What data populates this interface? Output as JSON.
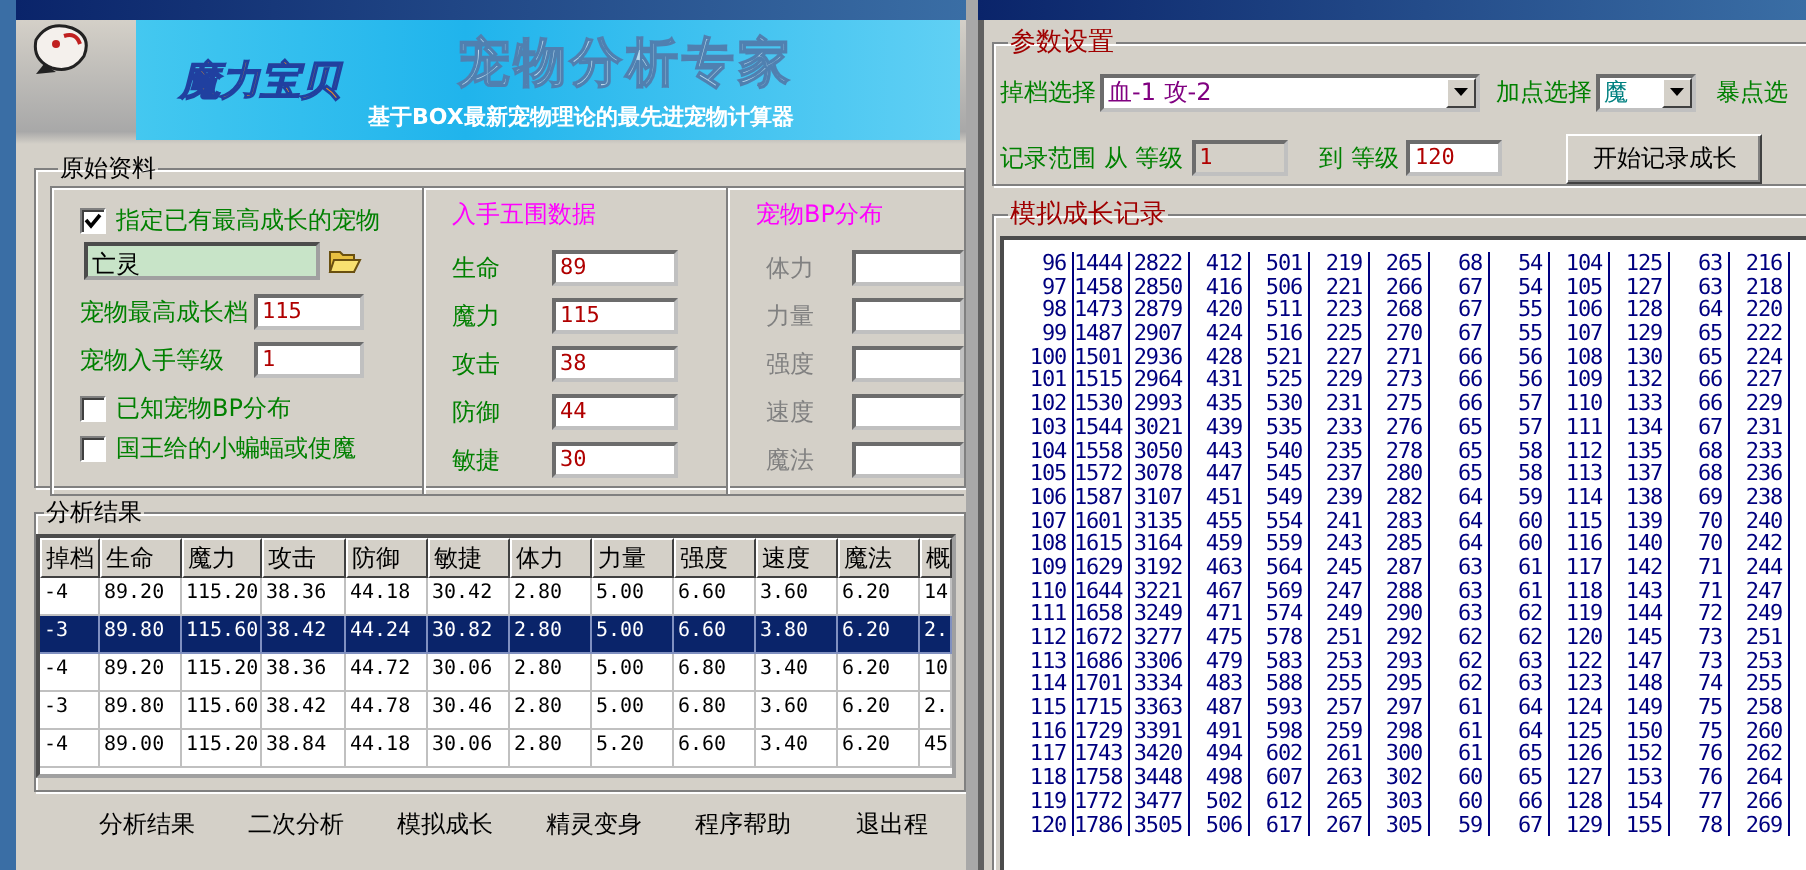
{
  "left_window": {
    "banner": {
      "logo": "魔力宝贝",
      "title": "宠物分析专家",
      "subtitle": "基于BOX最新宠物理论的最先进宠物计算器"
    },
    "original_data": {
      "title": "原始资料",
      "specify_pet": {
        "label": "指定已有最高成长的宠物",
        "checked": true
      },
      "pet_name": "亡灵",
      "max_growth": {
        "label": "宠物最高成长档",
        "value": "115"
      },
      "start_level": {
        "label": "宠物入手等级",
        "value": "1"
      },
      "options": [
        {
          "label": "已知宠物BP分布",
          "checked": false
        },
        {
          "label": "国王给的小蝙蝠或使魔",
          "checked": false
        }
      ],
      "stats": {
        "title": "入手五围数据",
        "fields": [
          {
            "label": "生命",
            "value": "89"
          },
          {
            "label": "魔力",
            "value": "115"
          },
          {
            "label": "攻击",
            "value": "38"
          },
          {
            "label": "防御",
            "value": "44"
          },
          {
            "label": "敏捷",
            "value": "30"
          }
        ]
      },
      "bp": {
        "title": "宠物BP分布",
        "disabled": true,
        "fields": [
          {
            "label": "体力"
          },
          {
            "label": "力量"
          },
          {
            "label": "强度"
          },
          {
            "label": "速度"
          },
          {
            "label": "魔法"
          }
        ]
      }
    },
    "results": {
      "title": "分析结果",
      "columns": [
        "掉档",
        "生命",
        "魔力",
        "攻击",
        "防御",
        "敏捷",
        "体力",
        "力量",
        "强度",
        "速度",
        "魔法",
        "概"
      ],
      "rows": [
        {
          "selected": false,
          "cells": [
            "-4",
            "89.20",
            "115.20",
            "38.36",
            "44.18",
            "30.42",
            "2.80",
            "5.00",
            "6.60",
            "3.60",
            "6.20",
            "14"
          ]
        },
        {
          "selected": true,
          "cells": [
            "-3",
            "89.80",
            "115.60",
            "38.42",
            "44.24",
            "30.82",
            "2.80",
            "5.00",
            "6.60",
            "3.80",
            "6.20",
            "2."
          ]
        },
        {
          "selected": false,
          "cells": [
            "-4",
            "89.20",
            "115.20",
            "38.36",
            "44.72",
            "30.06",
            "2.80",
            "5.00",
            "6.80",
            "3.40",
            "6.20",
            "10"
          ]
        },
        {
          "selected": false,
          "cells": [
            "-3",
            "89.80",
            "115.60",
            "38.42",
            "44.78",
            "30.46",
            "2.80",
            "5.00",
            "6.80",
            "3.60",
            "6.20",
            "2."
          ]
        },
        {
          "selected": false,
          "cells": [
            "-4",
            "89.00",
            "115.20",
            "38.84",
            "44.18",
            "30.06",
            "2.80",
            "5.20",
            "6.60",
            "3.40",
            "6.20",
            "45"
          ]
        }
      ]
    },
    "buttons": [
      "分析结果",
      "二次分析",
      "模拟成长",
      "精灵变身",
      "程序帮助",
      "退出程"
    ]
  },
  "right_window": {
    "params": {
      "title": "参数设置",
      "drop_select": {
        "label": "掉档选择",
        "value": "血-1 攻-2"
      },
      "point_select": {
        "label": "加点选择",
        "value": "魔"
      },
      "crit_label": "暴点选",
      "range_from_label": "记录范围 从 等级",
      "from_value": "1",
      "range_to_label": "到 等级",
      "to_value": "120",
      "start_button": "开始记录成长"
    },
    "record": {
      "title": "模拟成长记录",
      "rows": [
        [
          "96",
          "1444",
          "2822",
          "412",
          "501",
          "219",
          "265",
          "68",
          "54",
          "104",
          "125",
          "63",
          "216"
        ],
        [
          "97",
          "1458",
          "2850",
          "416",
          "506",
          "221",
          "266",
          "67",
          "54",
          "105",
          "127",
          "63",
          "218"
        ],
        [
          "98",
          "1473",
          "2879",
          "420",
          "511",
          "223",
          "268",
          "67",
          "55",
          "106",
          "128",
          "64",
          "220"
        ],
        [
          "99",
          "1487",
          "2907",
          "424",
          "516",
          "225",
          "270",
          "67",
          "55",
          "107",
          "129",
          "65",
          "222"
        ],
        [
          "100",
          "1501",
          "2936",
          "428",
          "521",
          "227",
          "271",
          "66",
          "56",
          "108",
          "130",
          "65",
          "224"
        ],
        [
          "101",
          "1515",
          "2964",
          "431",
          "525",
          "229",
          "273",
          "66",
          "56",
          "109",
          "132",
          "66",
          "227"
        ],
        [
          "102",
          "1530",
          "2993",
          "435",
          "530",
          "231",
          "275",
          "66",
          "57",
          "110",
          "133",
          "66",
          "229"
        ],
        [
          "103",
          "1544",
          "3021",
          "439",
          "535",
          "233",
          "276",
          "65",
          "57",
          "111",
          "134",
          "67",
          "231"
        ],
        [
          "104",
          "1558",
          "3050",
          "443",
          "540",
          "235",
          "278",
          "65",
          "58",
          "112",
          "135",
          "68",
          "233"
        ],
        [
          "105",
          "1572",
          "3078",
          "447",
          "545",
          "237",
          "280",
          "65",
          "58",
          "113",
          "137",
          "68",
          "236"
        ],
        [
          "106",
          "1587",
          "3107",
          "451",
          "549",
          "239",
          "282",
          "64",
          "59",
          "114",
          "138",
          "69",
          "238"
        ],
        [
          "107",
          "1601",
          "3135",
          "455",
          "554",
          "241",
          "283",
          "64",
          "60",
          "115",
          "139",
          "70",
          "240"
        ],
        [
          "108",
          "1615",
          "3164",
          "459",
          "559",
          "243",
          "285",
          "64",
          "60",
          "116",
          "140",
          "70",
          "242"
        ],
        [
          "109",
          "1629",
          "3192",
          "463",
          "564",
          "245",
          "287",
          "63",
          "61",
          "117",
          "142",
          "71",
          "244"
        ],
        [
          "110",
          "1644",
          "3221",
          "467",
          "569",
          "247",
          "288",
          "63",
          "61",
          "118",
          "143",
          "71",
          "247"
        ],
        [
          "111",
          "1658",
          "3249",
          "471",
          "574",
          "249",
          "290",
          "63",
          "62",
          "119",
          "144",
          "72",
          "249"
        ],
        [
          "112",
          "1672",
          "3277",
          "475",
          "578",
          "251",
          "292",
          "62",
          "62",
          "120",
          "145",
          "73",
          "251"
        ],
        [
          "113",
          "1686",
          "3306",
          "479",
          "583",
          "253",
          "293",
          "62",
          "63",
          "122",
          "147",
          "73",
          "253"
        ],
        [
          "114",
          "1701",
          "3334",
          "483",
          "588",
          "255",
          "295",
          "62",
          "63",
          "123",
          "148",
          "74",
          "255"
        ],
        [
          "115",
          "1715",
          "3363",
          "487",
          "593",
          "257",
          "297",
          "61",
          "64",
          "124",
          "149",
          "75",
          "258"
        ],
        [
          "116",
          "1729",
          "3391",
          "491",
          "598",
          "259",
          "298",
          "61",
          "64",
          "125",
          "150",
          "75",
          "260"
        ],
        [
          "117",
          "1743",
          "3420",
          "494",
          "602",
          "261",
          "300",
          "61",
          "65",
          "126",
          "152",
          "76",
          "262"
        ],
        [
          "118",
          "1758",
          "3448",
          "498",
          "607",
          "263",
          "302",
          "60",
          "65",
          "127",
          "153",
          "76",
          "264"
        ],
        [
          "119",
          "1772",
          "3477",
          "502",
          "612",
          "265",
          "303",
          "60",
          "66",
          "128",
          "154",
          "77",
          "266"
        ],
        [
          "120",
          "1786",
          "3505",
          "506",
          "617",
          "267",
          "305",
          "59",
          "67",
          "129",
          "155",
          "78",
          "269"
        ]
      ]
    }
  }
}
